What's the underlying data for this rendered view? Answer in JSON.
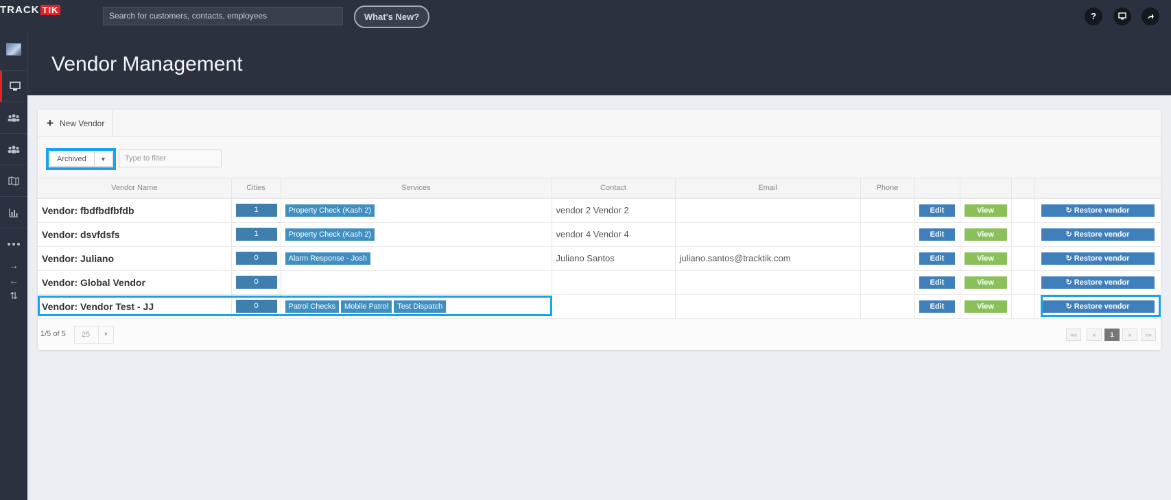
{
  "topbar": {
    "logo_track": "TRACK",
    "logo_tik": "TIK",
    "search_placeholder": "Search for customers, contacts, employees",
    "whats_new": "What's New?",
    "help_glyph": "?",
    "icons": [
      "question-icon",
      "monitor-icon",
      "share-icon"
    ]
  },
  "sidebar": {
    "icons": [
      "avatar",
      "monitor-icon",
      "users-icon",
      "group-icon",
      "map-icon",
      "chart-icon",
      "more-icon",
      "arrow-right-icon",
      "arrow-left-icon",
      "sort-icon"
    ]
  },
  "header": {
    "title": "Vendor Management"
  },
  "toolbar": {
    "new_vendor": "New Vendor"
  },
  "filter": {
    "status_value": "Archived",
    "filter_placeholder": "Type to filter"
  },
  "table": {
    "headers": [
      "Vendor Name",
      "Cities",
      "Services",
      "Contact",
      "Email",
      "Phone",
      "",
      "",
      "",
      ""
    ],
    "edit_label": "Edit",
    "view_label": "View",
    "restore_label": "Restore vendor",
    "rows": [
      {
        "name": "Vendor: fbdfbdfbfdb",
        "cities": "1",
        "services": [
          "Property Check (Kash 2)"
        ],
        "contact": "vendor 2 Vendor 2",
        "email": "",
        "phone": ""
      },
      {
        "name": "Vendor: dsvfdsfs",
        "cities": "1",
        "services": [
          "Property Check (Kash 2)"
        ],
        "contact": "vendor 4 Vendor 4",
        "email": "",
        "phone": ""
      },
      {
        "name": "Vendor: Juliano",
        "cities": "0",
        "services": [
          "Alarm Response - Josh"
        ],
        "contact": "Juliano Santos",
        "email": "juliano.santos@tracktik.com",
        "phone": ""
      },
      {
        "name": "Vendor: Global Vendor",
        "cities": "0",
        "services": [],
        "contact": "",
        "email": "",
        "phone": ""
      },
      {
        "name": "Vendor: Vendor Test - JJ",
        "cities": "0",
        "services": [
          "Patrol Checks",
          "Mobile Patrol",
          "Test Dispatch"
        ],
        "contact": "",
        "email": "",
        "phone": ""
      }
    ]
  },
  "footer": {
    "count": "1/5 of 5",
    "page_size": "25",
    "pages": [
      "««",
      "«",
      "1",
      "»",
      "»»"
    ]
  },
  "colors": {
    "accent_highlight": "#1aa3e8",
    "edit_blue": "#3f7fbc",
    "view_green": "#8ac05a",
    "brand_red": "#e2232a"
  }
}
